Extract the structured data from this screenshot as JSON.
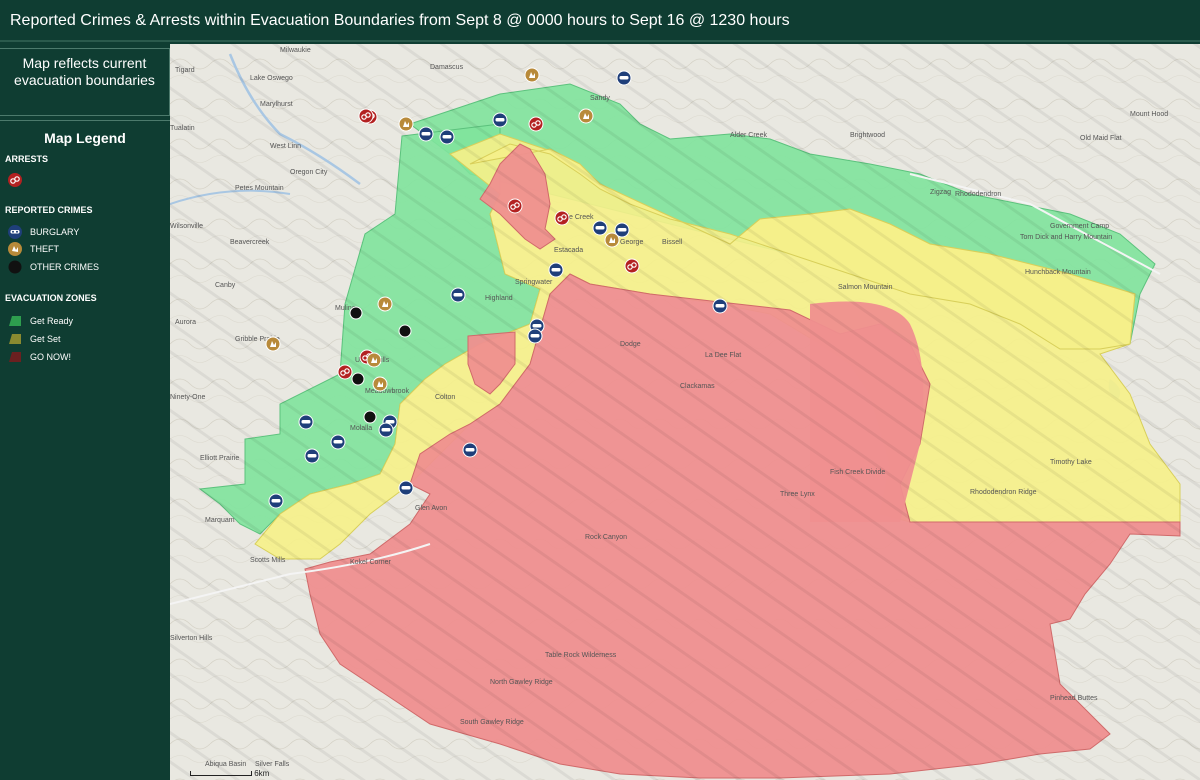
{
  "header": {
    "title": "Reported Crimes & Arrests within Evacuation Boundaries from Sept 8 @ 0000 hours to Sept 16 @ 1230 hours"
  },
  "note": {
    "line1": "Map reflects current",
    "line2": "evacuation boundaries"
  },
  "legend": {
    "title": "Map Legend",
    "arrests_heading": "ARRESTS",
    "crimes_heading": "REPORTED CRIMES",
    "burglary": "BURGLARY",
    "theft": "THEFT",
    "other": "OTHER CRIMES",
    "zones_heading": "EVACUATION ZONES",
    "get_ready": "Get Ready",
    "get_set": "Get Set",
    "go_now": "GO NOW!"
  },
  "colors": {
    "get_ready": "#80e39c",
    "get_set": "#f5f08a",
    "go_now": "#ef8f8f",
    "burglary": "#1f3f7a",
    "theft": "#b88a3a",
    "arrest": "#b32121",
    "other": "#111111"
  },
  "map": {
    "places": [
      "Milwaukie",
      "Lake Oswego",
      "Tigard",
      "Marylhurst",
      "Tualatin",
      "West Linn",
      "Oregon City",
      "Petes Mountain",
      "Wilsonville",
      "Beavercreek",
      "Canby",
      "Mulino",
      "Aurora",
      "Gribble Prairie",
      "Union Mills",
      "Meadowbrook",
      "Ninety-One",
      "Molalla",
      "Elliott Prairie",
      "Marquam",
      "Scotts Mills",
      "Kokel Corner",
      "Glen Avon",
      "Colton",
      "Dodge",
      "Highland",
      "Springwater",
      "Estacada",
      "Eagle Creek",
      "George",
      "Bissell",
      "Damascus",
      "Sandy",
      "Alder Creek",
      "Brightwood",
      "Zigzag",
      "Rhododendron",
      "Government Camp",
      "Three Lynx",
      "La Dee Flat",
      "Silverton Hills",
      "Silver Falls",
      "Abiqua Basin",
      "Pinhead Buttes",
      "Old Maid Flat",
      "Mount Hood",
      "Salmon Mountain",
      "Tom Dick and Harry Mountain",
      "Hunchback Mountain",
      "Rock Canyon",
      "North Gawley Ridge",
      "South Gawley Ridge",
      "Table Rock Wilderness",
      "Fish Creek Divide",
      "Rhododendron Ridge",
      "Timothy Lake",
      "Clackamas"
    ],
    "scale_label": "6km"
  }
}
